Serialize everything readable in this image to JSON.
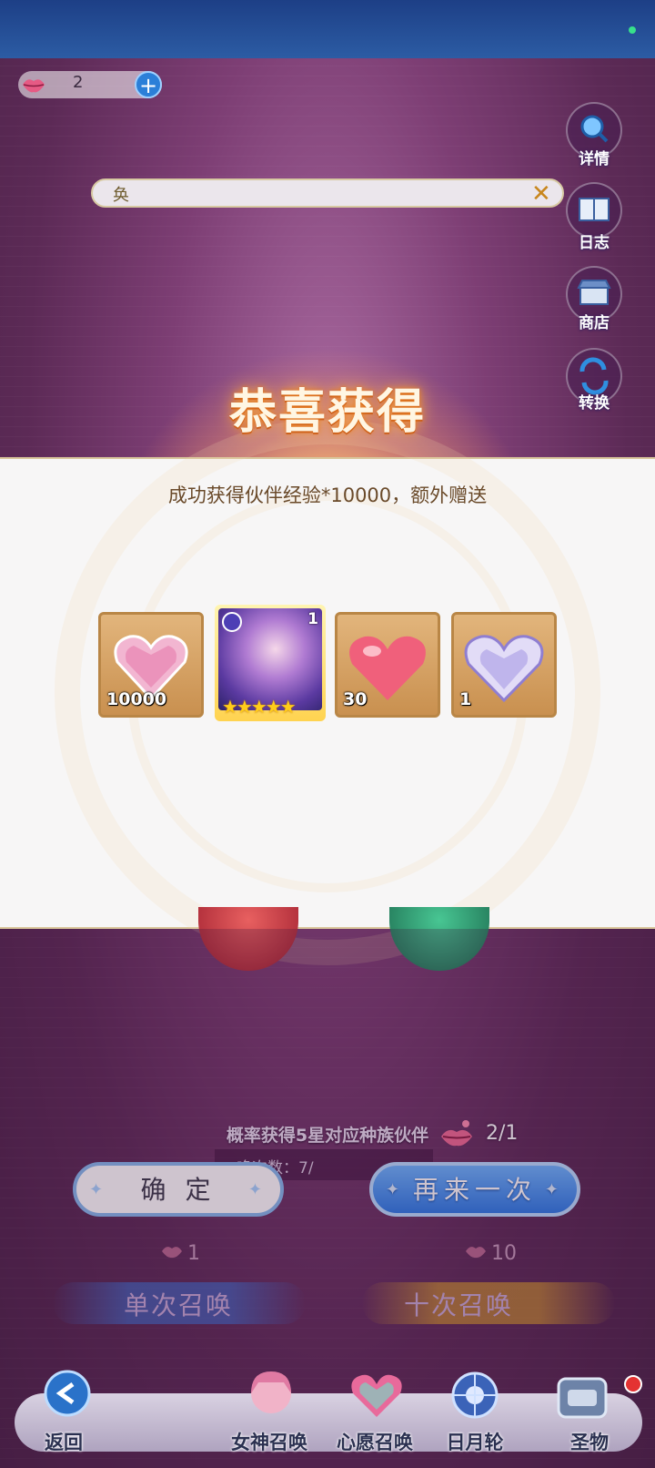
{
  "currency": {
    "value": "2",
    "plus_label": "+",
    "icon": "lips-icon"
  },
  "side_menu": [
    {
      "label": "详情",
      "icon": "magnifier-icon"
    },
    {
      "label": "日志",
      "icon": "book-icon"
    },
    {
      "label": "商店",
      "icon": "shop-icon"
    },
    {
      "label": "转换",
      "icon": "swap-icon"
    }
  ],
  "search": {
    "text": "奂",
    "close_symbol": "✕"
  },
  "popup": {
    "title": "恭喜获得",
    "subtitle": "成功获得伙伴经验*10000，额外赠送",
    "items": [
      {
        "name": "经验",
        "qty": "10000",
        "icon": "exp-crystal-heart-icon"
      },
      {
        "name": "hero",
        "qty": "1",
        "stars": "★★★★★",
        "icon": "hero-portrait"
      },
      {
        "name": "heart",
        "qty": "30",
        "icon": "pink-heart-icon"
      },
      {
        "name": "crystal heart",
        "qty": "1",
        "icon": "crystal-heart-icon"
      }
    ]
  },
  "summon_info": {
    "probability_text": "概率获得5星对应种族伙伴",
    "count_text": "唤次数：7/",
    "ticket_count": "2/1"
  },
  "actions": {
    "confirm": "确 定",
    "again": "再来一次"
  },
  "summon": {
    "single": {
      "cost": "1",
      "label": "单次召唤"
    },
    "ten": {
      "cost": "10",
      "label": "十次召唤"
    }
  },
  "nav": [
    {
      "label": "返回",
      "icon": "back-arrow-icon"
    },
    {
      "label": "女神召唤",
      "icon": "goddess-icon"
    },
    {
      "label": "心愿召唤",
      "icon": "wish-heart-icon"
    },
    {
      "label": "日月轮",
      "icon": "sun-moon-wheel-icon"
    },
    {
      "label": "圣物",
      "icon": "relic-chest-icon"
    }
  ],
  "colors": {
    "accent_blue": "#2d7be6",
    "title_glow": "#e77b1e",
    "panel_bg": "#f7f6f6"
  }
}
